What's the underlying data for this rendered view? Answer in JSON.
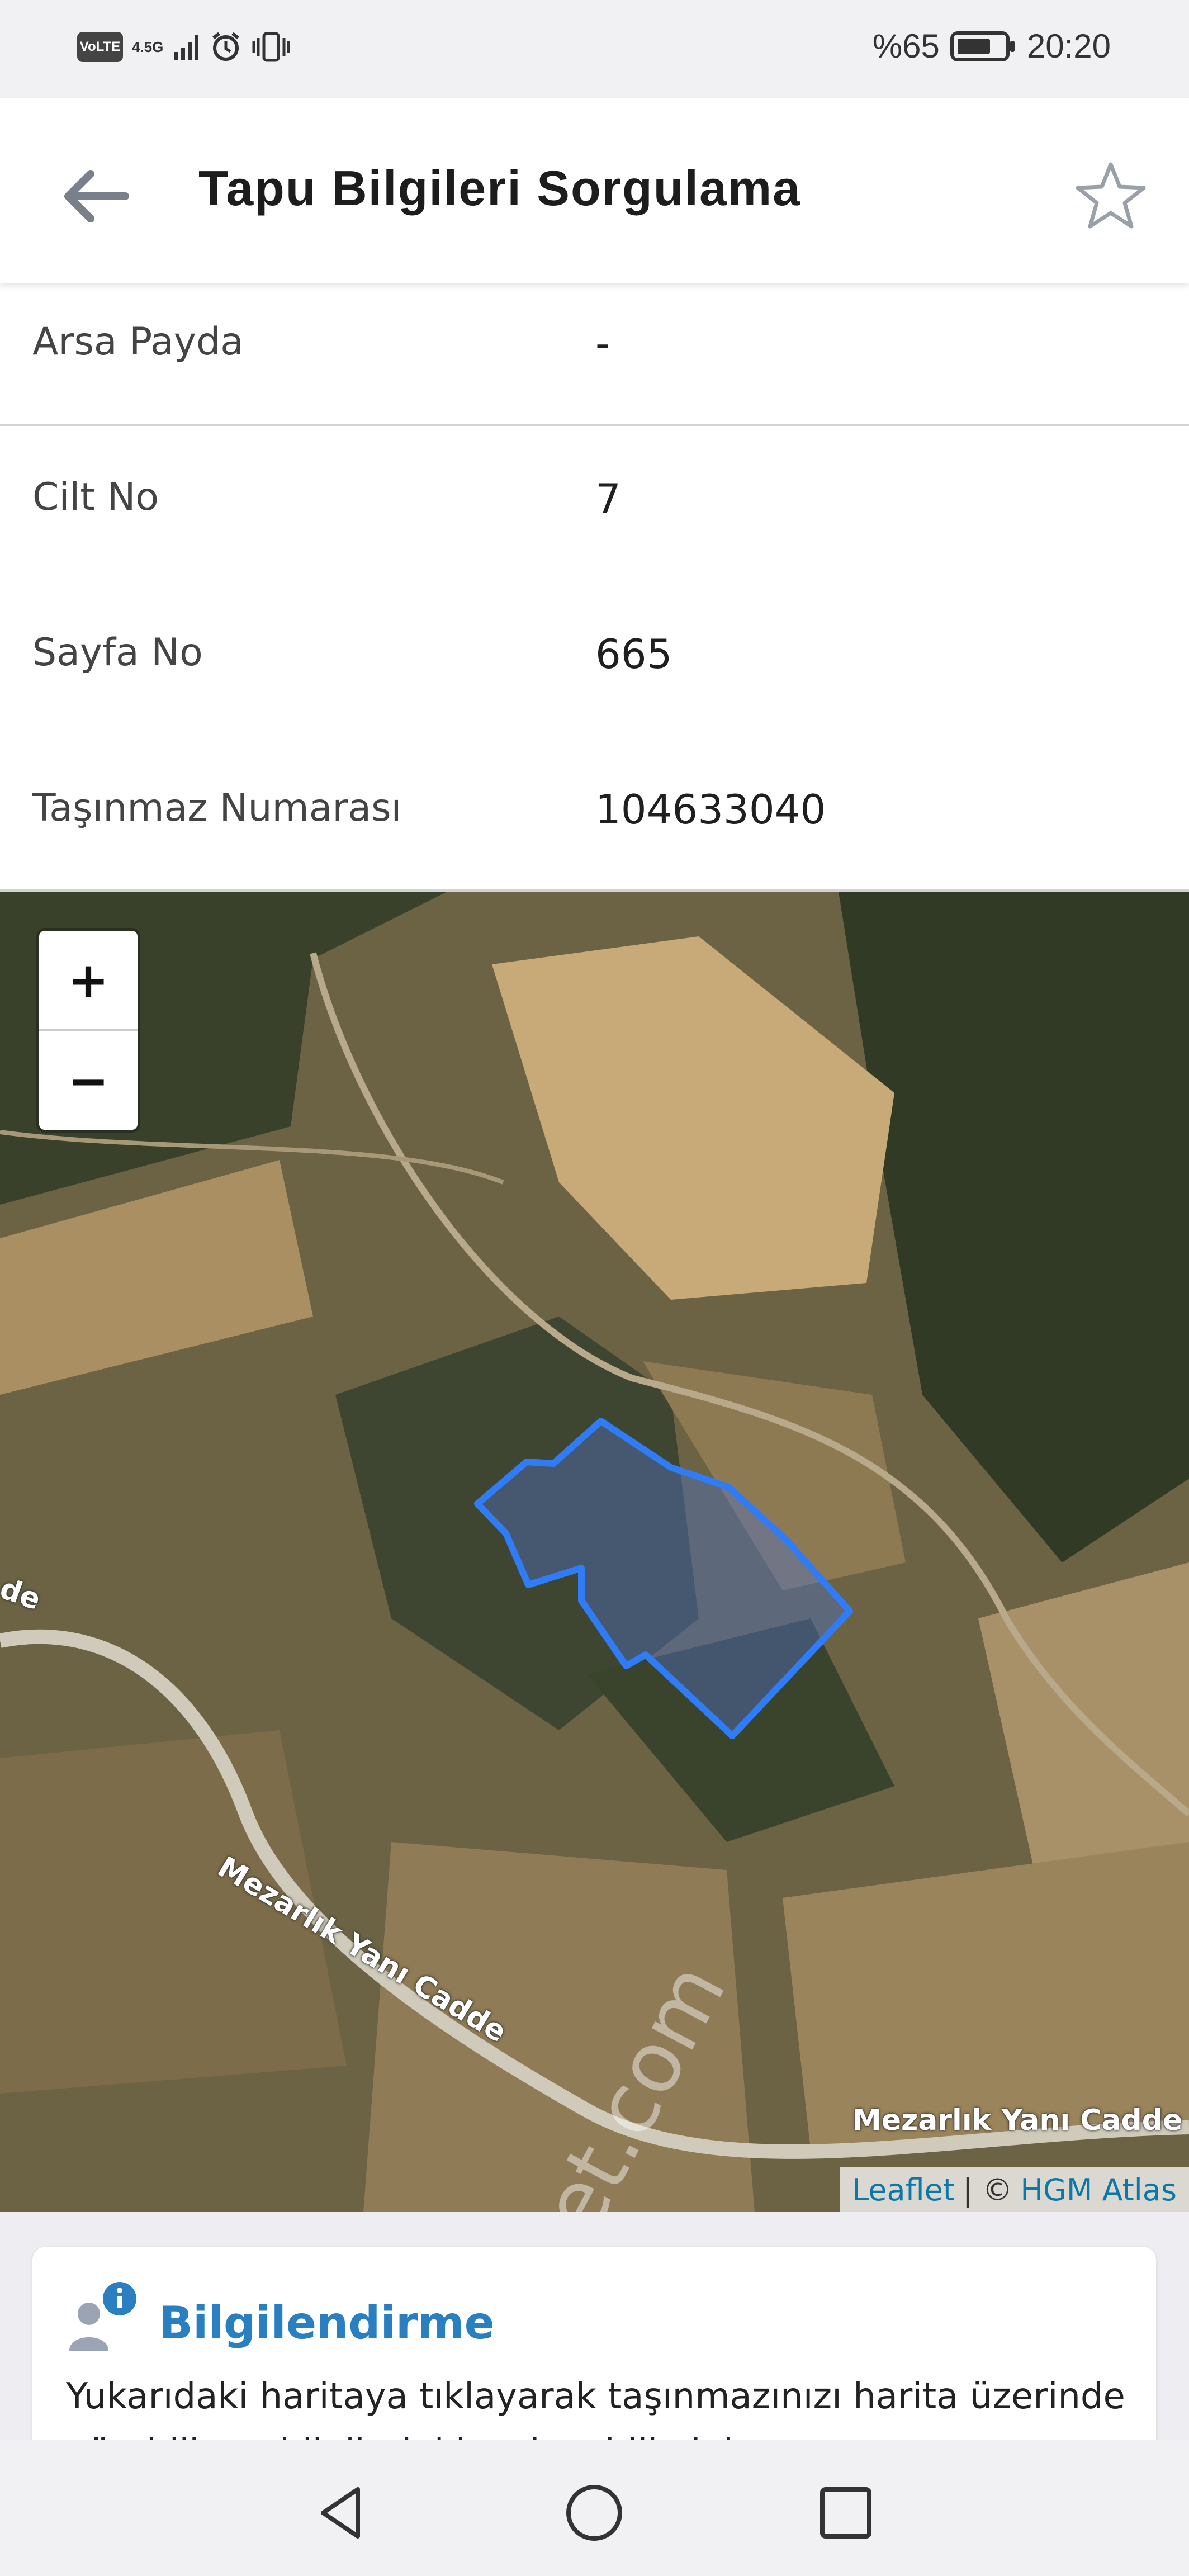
{
  "status_bar": {
    "left_badges": [
      "VoLTE",
      "4.5G"
    ],
    "battery_text": "%65",
    "time": "20:20",
    "icons": [
      "signal-icon",
      "alarm-icon",
      "vibrate-icon",
      "battery-icon"
    ]
  },
  "header": {
    "title": "Tapu Bilgileri Sorgulama",
    "back_icon": "arrow-left-icon",
    "favorite_icon": "star-outline-icon"
  },
  "info_rows": [
    {
      "label": "Arsa Payda",
      "value": "-"
    },
    {
      "label": "Cilt No",
      "value": "7"
    },
    {
      "label": "Sayfa No",
      "value": "665"
    },
    {
      "label": "Taşınmaz Numarası",
      "value": "104633040"
    }
  ],
  "map": {
    "zoom_in": "+",
    "zoom_out": "−",
    "road_labels": [
      "Mezarlık Yanı Cadde",
      "Mezarlık Yanı Cadde",
      "de"
    ],
    "watermark": "emlakjet.com",
    "attribution": {
      "leaflet": "Leaflet",
      "sep": "| ©",
      "atlas": "HGM Atlas"
    },
    "parcel_color": "#2f7cf6"
  },
  "info_card": {
    "title": "Bilgilendirme",
    "text": "Yukarıdaki haritaya tıklayarak taşınmazınızı harita üzerinde görebilir ve bilgilerini inceleyebilirsiniz.",
    "accent_color": "#2a7fc1"
  },
  "nav_bar": {
    "icons": [
      "back-triangle-icon",
      "home-circle-icon",
      "recents-square-icon"
    ]
  }
}
